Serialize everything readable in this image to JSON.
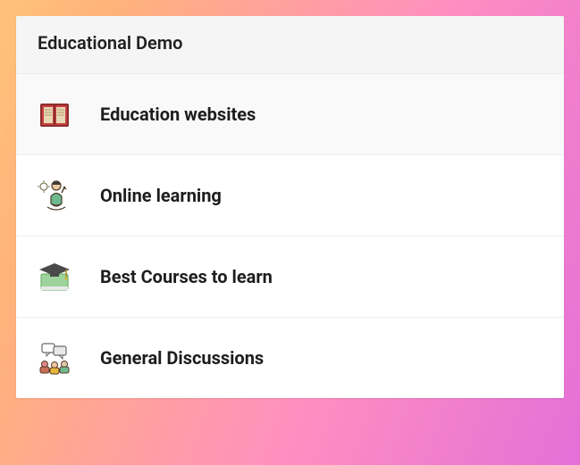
{
  "header": {
    "title": "Educational Demo"
  },
  "items": [
    {
      "label": "Education websites",
      "icon": "book-icon",
      "active": true
    },
    {
      "label": "Online learning",
      "icon": "learner-icon",
      "active": false
    },
    {
      "label": "Best Courses to learn",
      "icon": "grad-cap-icon",
      "active": false
    },
    {
      "label": "General Discussions",
      "icon": "discussion-icon",
      "active": false
    }
  ]
}
